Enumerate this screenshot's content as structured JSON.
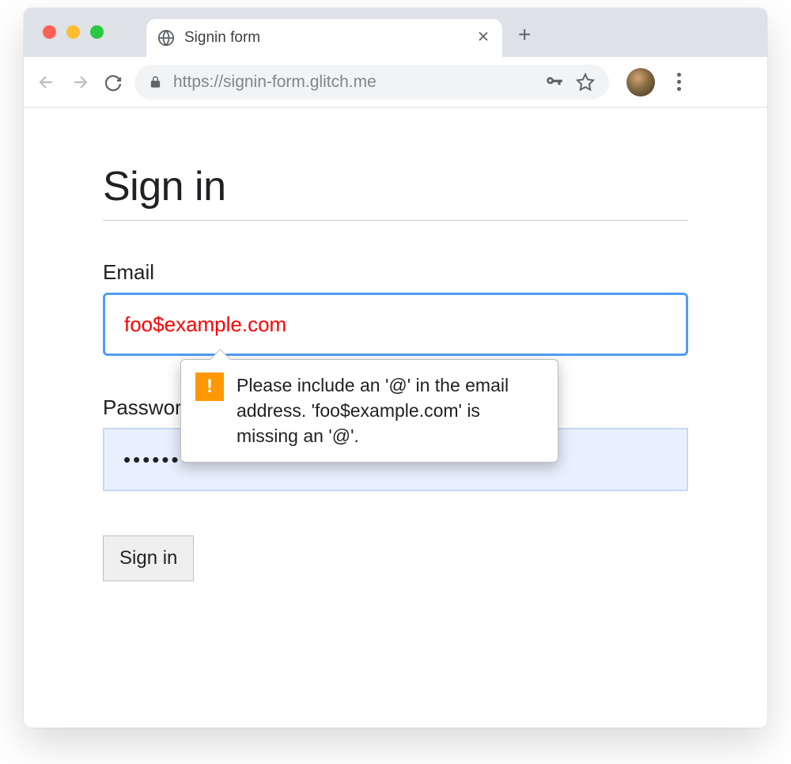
{
  "browser": {
    "tab_title": "Signin form",
    "url": "https://signin-form.glitch.me"
  },
  "page": {
    "title": "Sign in"
  },
  "form": {
    "email_label": "Email",
    "email_value": "foo$example.com",
    "password_label": "Password",
    "password_value": "••••••••••",
    "submit_label": "Sign in"
  },
  "validation": {
    "message": "Please include an '@' in the email address. 'foo$example.com' is missing an '@'."
  }
}
